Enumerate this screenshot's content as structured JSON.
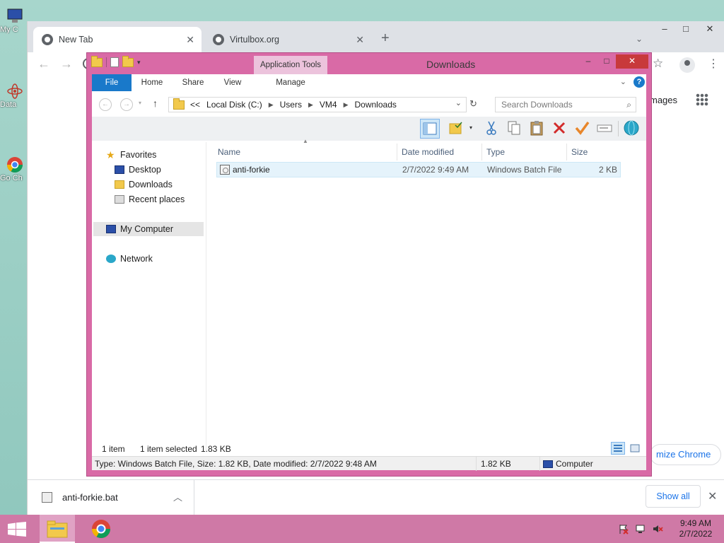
{
  "desktop": {
    "icons": [
      {
        "label": "My C",
        "icon": "computer-icon"
      },
      {
        "label": "Data",
        "icon": "atom-icon"
      },
      {
        "label": "Go Ch",
        "icon": "chrome-icon"
      }
    ]
  },
  "chrome": {
    "tabs": [
      {
        "title": "New Tab",
        "active": true
      },
      {
        "title": "Virtulbox.org",
        "active": false
      }
    ],
    "new_tab_symbol": "+",
    "ntp": {
      "images_label": "mages",
      "customize_label": "mize Chrome"
    },
    "download_bar": {
      "file_name": "anti-forkie.bat",
      "show_all_label": "Show all"
    }
  },
  "explorer": {
    "title": "Downloads",
    "contextual_tab": "Application Tools",
    "ribbon_tabs": [
      "File",
      "Home",
      "Share",
      "View",
      "Manage"
    ],
    "address": {
      "prefix": "<<",
      "segments": [
        "Local Disk (C:)",
        "Users",
        "VM4",
        "Downloads"
      ]
    },
    "search_placeholder": "Search Downloads",
    "nav": {
      "favorites": "Favorites",
      "desktop": "Desktop",
      "downloads": "Downloads",
      "recent": "Recent places",
      "my_computer": "My Computer",
      "network": "Network"
    },
    "columns": [
      "Name",
      "Date modified",
      "Type",
      "Size"
    ],
    "files": [
      {
        "name": "anti-forkie",
        "date_modified": "2/7/2022 9:49 AM",
        "type": "Windows Batch File",
        "size": "2 KB"
      }
    ],
    "status": {
      "item_count": "1 item",
      "selection": "1 item selected",
      "selection_size": "1.83 KB"
    },
    "status_bar": {
      "details": "Type: Windows Batch File, Size: 1.82 KB, Date modified: 2/7/2022 9:48 AM",
      "size": "1.82 KB",
      "location": "Computer"
    }
  },
  "taskbar": {
    "time": "9:49 AM",
    "date": "2/7/2022"
  },
  "colors": {
    "window_frame": "#d96aa6",
    "taskbar": "#cf79a6",
    "file_tab": "#1979ca",
    "close_button": "#c8393b"
  }
}
